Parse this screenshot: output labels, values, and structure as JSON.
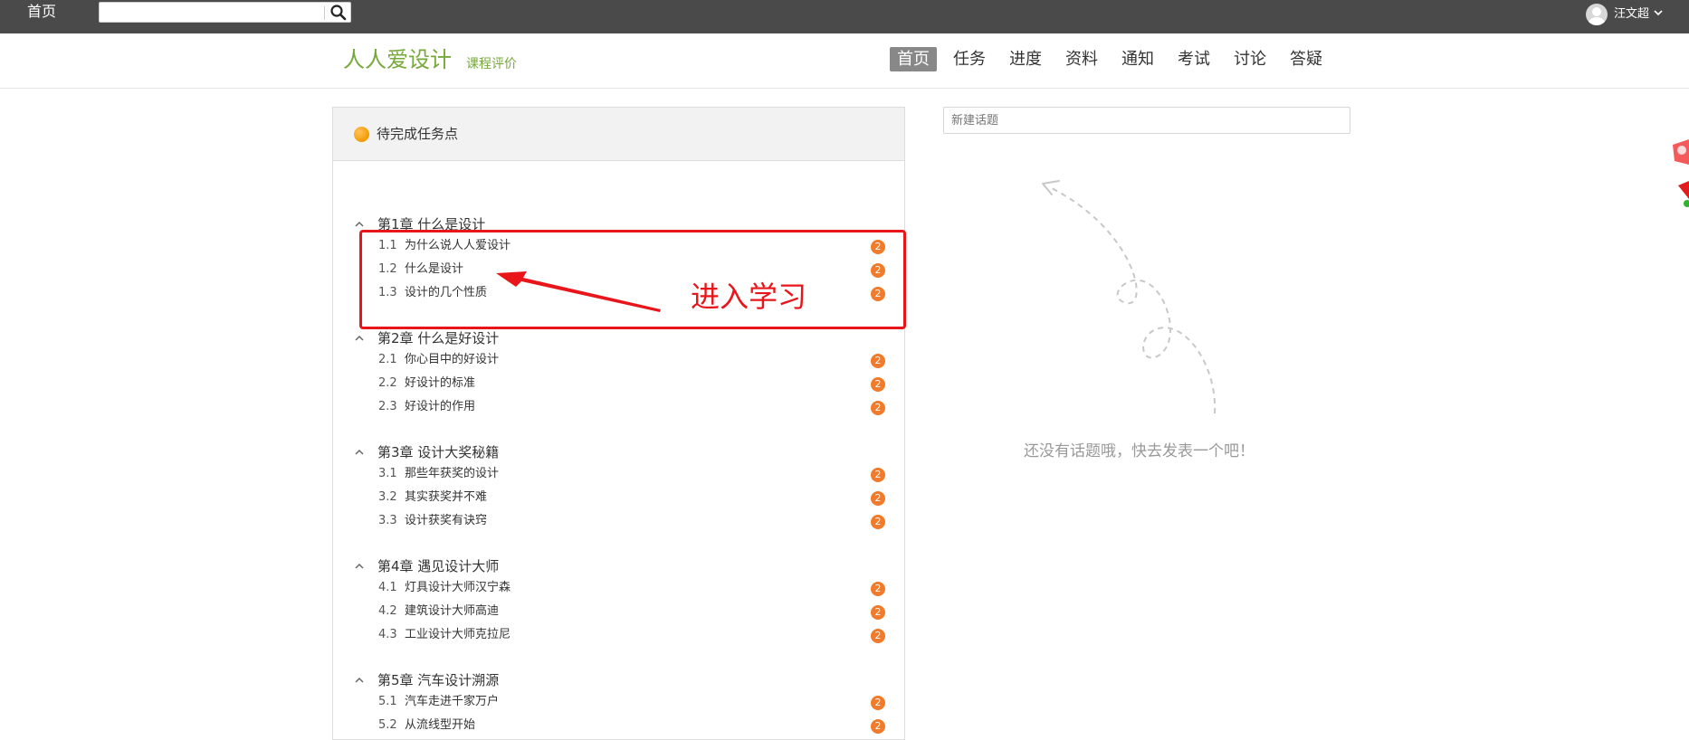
{
  "topbar": {
    "home": "首页",
    "search": {
      "value": "",
      "placeholder": ""
    },
    "user_name": "汪文超"
  },
  "header": {
    "logo": "人人爱设计",
    "subtitle": "课程评价",
    "nav": [
      "首页",
      "任务",
      "进度",
      "资料",
      "通知",
      "考试",
      "讨论",
      "答疑"
    ],
    "active_nav": "首页"
  },
  "tasks": {
    "title": "待完成任务点",
    "chapters": [
      {
        "label": "第1章 什么是设计",
        "sections": [
          {
            "num": "1.1",
            "title": "为什么说人人爱设计",
            "badge": "2"
          },
          {
            "num": "1.2",
            "title": "什么是设计",
            "badge": "2"
          },
          {
            "num": "1.3",
            "title": "设计的几个性质",
            "badge": "2"
          }
        ]
      },
      {
        "label": "第2章 什么是好设计",
        "sections": [
          {
            "num": "2.1",
            "title": "你心目中的好设计",
            "badge": "2"
          },
          {
            "num": "2.2",
            "title": "好设计的标准",
            "badge": "2"
          },
          {
            "num": "2.3",
            "title": "好设计的作用",
            "badge": "2"
          }
        ]
      },
      {
        "label": "第3章 设计大奖秘籍",
        "sections": [
          {
            "num": "3.1",
            "title": "那些年获奖的设计",
            "badge": "2"
          },
          {
            "num": "3.2",
            "title": "其实获奖并不难",
            "badge": "2"
          },
          {
            "num": "3.3",
            "title": "设计获奖有诀窍",
            "badge": "2"
          }
        ]
      },
      {
        "label": "第4章 遇见设计大师",
        "sections": [
          {
            "num": "4.1",
            "title": "灯具设计大师汉宁森",
            "badge": "2"
          },
          {
            "num": "4.2",
            "title": "建筑设计大师高迪",
            "badge": "2"
          },
          {
            "num": "4.3",
            "title": "工业设计大师克拉尼",
            "badge": "2"
          }
        ]
      },
      {
        "label": "第5章 汽车设计溯源",
        "sections": [
          {
            "num": "5.1",
            "title": "汽车走进千家万户",
            "badge": "2"
          },
          {
            "num": "5.2",
            "title": "从流线型开始",
            "badge": "2"
          }
        ]
      }
    ]
  },
  "annotation": {
    "text": "进入学习",
    "color": "#e8161a"
  },
  "discussion": {
    "new_topic_placeholder": "新建话题",
    "empty_text": "还没有话题哦，快去发表一个吧！"
  },
  "colors": {
    "accent_green": "#76a83a",
    "badge_orange": "#f07b2c",
    "topbar": "#4a4a4a"
  },
  "icons": [
    "search-icon",
    "avatar-icon",
    "caret-down-icon",
    "chevron-up-icon",
    "arrow-icon"
  ]
}
